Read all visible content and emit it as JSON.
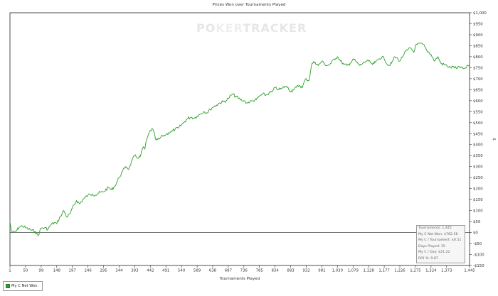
{
  "page": {
    "title": "Prizes Won over Tournaments Played",
    "watermark": "POKERTRACKER",
    "watermark_parts": [
      "PO",
      "KER",
      "TRACKER"
    ]
  },
  "chart_data": {
    "type": "line",
    "title": "Prizes Won over Tournaments Played",
    "xlabel": "Tournaments Played",
    "ylabel": "$",
    "xlim": [
      1,
      1445
    ],
    "ylim": [
      -150,
      1000
    ],
    "x_ticks": [
      1,
      50,
      99,
      148,
      197,
      246,
      295,
      344,
      393,
      442,
      491,
      540,
      589,
      638,
      687,
      736,
      785,
      834,
      883,
      932,
      981,
      1030,
      1079,
      1128,
      1177,
      1226,
      1275,
      1324,
      1373,
      1445
    ],
    "x_tick_labels": [
      "1",
      "50",
      "99",
      "148",
      "197",
      "246",
      "295",
      "344",
      "393",
      "442",
      "491",
      "540",
      "589",
      "638",
      "687",
      "736",
      "785",
      "834",
      "883",
      "932",
      "981",
      "1,030",
      "1,079",
      "1,128",
      "1,177",
      "1,226",
      "1,275",
      "1,324",
      "1,373",
      "1,445"
    ],
    "y_ticks": [
      -150,
      -100,
      -50,
      0,
      50,
      100,
      150,
      200,
      250,
      300,
      350,
      400,
      450,
      500,
      550,
      600,
      650,
      700,
      750,
      800,
      850,
      900,
      950,
      1000
    ],
    "y_tick_labels": [
      "-$150",
      "-$100",
      "-$50",
      "$0",
      "$50",
      "$100",
      "$150",
      "$200",
      "$250",
      "$300",
      "$350",
      "$400",
      "$450",
      "$500",
      "$550",
      "$600",
      "$650",
      "$700",
      "$750",
      "$800",
      "$850",
      "$900",
      "$950",
      "$1,000"
    ],
    "grid": false,
    "legend_position": "bottom-left",
    "series": [
      {
        "name": "My C Net Won",
        "color": "#2ca02c",
        "x": [
          1,
          5,
          10,
          20,
          30,
          40,
          50,
          60,
          70,
          80,
          90,
          95,
          99,
          110,
          120,
          130,
          140,
          148,
          160,
          170,
          180,
          190,
          197,
          210,
          220,
          230,
          246,
          260,
          270,
          280,
          295,
          310,
          320,
          330,
          344,
          355,
          365,
          375,
          385,
          393,
          400,
          410,
          420,
          425,
          430,
          442,
          450,
          460,
          470,
          480,
          491,
          500,
          510,
          520,
          530,
          540,
          550,
          560,
          570,
          580,
          589,
          600,
          610,
          620,
          630,
          638,
          650,
          660,
          670,
          680,
          687,
          700,
          710,
          720,
          730,
          736,
          745,
          755,
          765,
          775,
          785,
          795,
          805,
          815,
          825,
          834,
          845,
          855,
          865,
          875,
          883,
          890,
          900,
          910,
          920,
          925,
          932,
          940,
          950,
          960,
          970,
          981,
          990,
          1000,
          1010,
          1020,
          1030,
          1040,
          1050,
          1060,
          1070,
          1079,
          1090,
          1100,
          1110,
          1120,
          1128,
          1140,
          1150,
          1160,
          1170,
          1177,
          1190,
          1200,
          1210,
          1220,
          1226,
          1240,
          1250,
          1260,
          1270,
          1275,
          1290,
          1300,
          1310,
          1324,
          1335,
          1345,
          1355,
          1373,
          1385,
          1395,
          1405,
          1415,
          1425,
          1435,
          1440,
          1445
        ],
        "y": [
          50,
          10,
          0,
          5,
          25,
          30,
          22,
          15,
          10,
          5,
          -15,
          10,
          20,
          22,
          15,
          35,
          45,
          40,
          75,
          100,
          70,
          85,
          110,
          145,
          130,
          150,
          170,
          175,
          170,
          180,
          185,
          205,
          195,
          210,
          250,
          280,
          300,
          290,
          330,
          350,
          340,
          345,
          390,
          380,
          420,
          465,
          470,
          420,
          425,
          440,
          445,
          455,
          460,
          470,
          475,
          490,
          505,
          520,
          525,
          520,
          530,
          540,
          550,
          545,
          560,
          570,
          580,
          590,
          595,
          600,
          610,
          630,
          620,
          610,
          600,
          600,
          590,
          595,
          600,
          605,
          620,
          630,
          625,
          635,
          640,
          660,
          650,
          655,
          665,
          660,
          640,
          650,
          660,
          670,
          660,
          685,
          700,
          690,
          770,
          775,
          760,
          780,
          765,
          760,
          770,
          790,
          800,
          780,
          765,
          760,
          770,
          790,
          775,
          760,
          770,
          780,
          780,
          765,
          775,
          790,
          800,
          790,
          760,
          770,
          800,
          790,
          780,
          815,
          830,
          840,
          820,
          850,
          860,
          855,
          830,
          810,
          780,
          800,
          770,
          760,
          750,
          755,
          745,
          755,
          745,
          750,
          760,
          765
        ]
      }
    ]
  },
  "stats": [
    "Tournaments: 1,445",
    "My C Net Won: $762.58",
    "My C / Tournament: $0.51",
    "Days Played: 35",
    "My C / Day: $21.22",
    "ROI %: 9.87"
  ],
  "legend": {
    "label": "My C Net Won",
    "color": "#2ca02c"
  }
}
